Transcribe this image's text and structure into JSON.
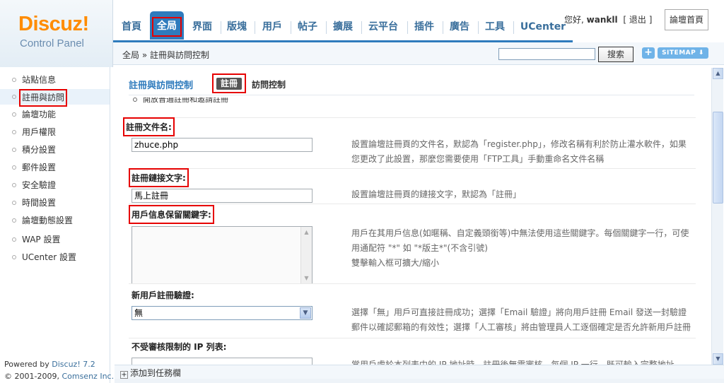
{
  "logo": {
    "main": "Discuz!",
    "sub": "Control Panel"
  },
  "nav": {
    "items": [
      "首頁",
      "全局",
      "界面",
      "版塊",
      "用戶",
      "帖子",
      "擴展",
      "云平台",
      "插件",
      "廣告",
      "工具",
      "UCenter"
    ],
    "active": "全局"
  },
  "user": {
    "greeting": "您好,",
    "name": "wankll",
    "logout": "[ 退出 ]",
    "forum_home": "論壇首頁"
  },
  "breadcrumb": "全局 » 註冊與訪問控制",
  "search": {
    "value": "",
    "button": "搜索"
  },
  "toolbar": {
    "plus": "+",
    "sitemap": "SITEMAP"
  },
  "sidebar": {
    "items": [
      "站點信息",
      "註冊與訪問",
      "論壇功能",
      "用戶權限",
      "積分設置",
      "郵件設置",
      "安全驗證",
      "時間設置",
      "論壇動態設置",
      "WAP 設置",
      "UCenter 設置"
    ],
    "active_index": 1
  },
  "footer": {
    "powered_prefix": "Powered by ",
    "brand": "Discuz!",
    "version": "7.2",
    "copyright_prefix": "© 2001-2009, ",
    "company": "Comsenz Inc."
  },
  "main": {
    "title": "註冊與訪問控制",
    "tab_register": "註冊",
    "tab_access": "訪問控制",
    "cutoff_text": "開放普通註冊和邀請註冊",
    "fields": [
      {
        "label": "註冊文件名:",
        "value": "zhuce.php",
        "desc": "設置論壇註冊頁的文件名，默認為「register.php」，修改名稱有利於防止灌水軟件，如果您更改了此設置，那麼您需要使用「FTP工具」手動重命名文件名稱"
      },
      {
        "label": "註冊鏈接文字:",
        "value": "馬上註冊",
        "desc": "設置論壇註冊頁的鏈接文字，默認為「註冊」"
      },
      {
        "label": "用戶信息保留關鍵字:",
        "value": "",
        "desc_lines": [
          "用戶在其用戶信息(如暱稱、自定義頭銜等)中無法使用這些關鍵字。每個關鍵字一行，可使用通配符 \"*\" 如 \"*版主*\"(不含引號)",
          "雙擊輸入框可擴大/縮小"
        ]
      },
      {
        "label": "新用戶註冊驗證:",
        "value": "無",
        "desc": "選擇「無」用戶可直接註冊成功；選擇「Email 驗證」將向用戶註冊 Email 發送一封驗證郵件以確認郵箱的有效性；選擇「人工審核」將由管理員人工逐個確定是否允許新用戶註冊"
      },
      {
        "label": "不受審核限制的 IP 列表:",
        "desc": "當用戶處於本列表中的 IP 地址時，註冊後無需審核。每個 IP 一行，既可輸入完整地址，"
      }
    ]
  },
  "bottom": {
    "add_task": "添加到任務欄"
  }
}
